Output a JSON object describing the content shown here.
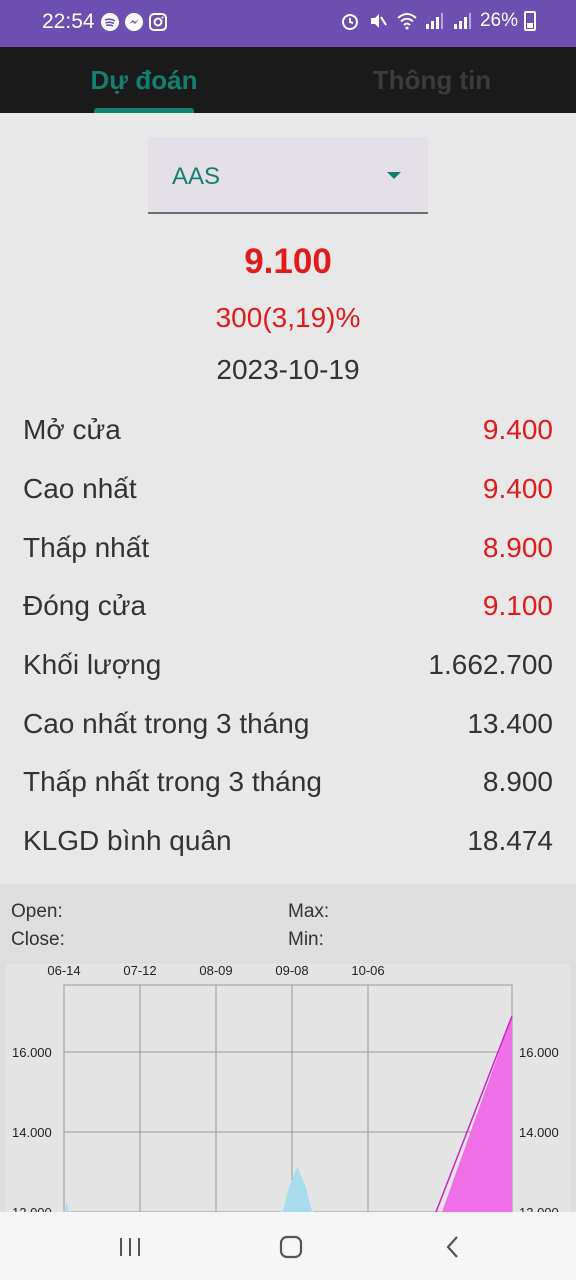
{
  "status_bar": {
    "time": "22:54",
    "battery": "26%",
    "app_icons": [
      "spotify-icon",
      "messenger-icon",
      "instagram-icon"
    ],
    "system_icons": [
      "alarm-icon",
      "mute-icon",
      "wifi-icon",
      "signal-icon",
      "signal-icon",
      "battery-icon"
    ]
  },
  "tabs": [
    {
      "label": "Dự đoán",
      "active": true
    },
    {
      "label": "Thông tin",
      "active": false
    }
  ],
  "ticker": {
    "selected": "AAS"
  },
  "quote": {
    "price": "9.100",
    "change": "300(3,19)%",
    "date": "2023-10-19"
  },
  "stats": [
    {
      "label": "Mở cửa",
      "value": "9.400",
      "color": "#e11b1b"
    },
    {
      "label": "Cao nhất",
      "value": "9.400",
      "color": "#e11b1b"
    },
    {
      "label": "Thấp nhất",
      "value": "8.900",
      "color": "#e11b1b"
    },
    {
      "label": "Đóng cửa",
      "value": "9.100",
      "color": "#e11b1b"
    },
    {
      "label": "Khối lượng",
      "value": "1.662.700",
      "color": "#333333"
    },
    {
      "label": "Cao nhất trong 3 tháng",
      "value": "13.400",
      "color": "#333333"
    },
    {
      "label": "Thấp nhất trong 3 tháng",
      "value": "8.900",
      "color": "#333333"
    },
    {
      "label": "KLGD bình quân",
      "value": "18.474",
      "color": "#333333"
    }
  ],
  "chart_legend": {
    "open": "Open:",
    "close": "Close:",
    "max": "Max:",
    "min": "Min:"
  },
  "chart_data": {
    "type": "area",
    "x_ticks": [
      "06-14",
      "07-12",
      "08-09",
      "09-08",
      "10-06"
    ],
    "y_ticks": [
      "16.000",
      "14.000",
      "12.000"
    ],
    "ylim_visible": [
      12000,
      17000
    ],
    "series": [
      {
        "color": "#a8dcec",
        "x": [
          "06-14",
          "06-15",
          "06-16",
          "09-02",
          "09-05",
          "09-08",
          "09-11",
          "09-14"
        ],
        "values": [
          11800,
          12200,
          11800,
          11800,
          12600,
          13100,
          12600,
          11800
        ]
      },
      {
        "color": "#ee6fe8",
        "x": [
          "10-06",
          "10-19"
        ],
        "values": [
          12000,
          16900
        ]
      }
    ],
    "colors": {
      "grid": "#999999",
      "area_fill": "#ee6fe8",
      "area_line": "#cc22cc",
      "light_area": "#a8dcec"
    }
  },
  "nav_bar": {
    "icons": [
      "recents-icon",
      "home-icon",
      "back-icon"
    ]
  }
}
